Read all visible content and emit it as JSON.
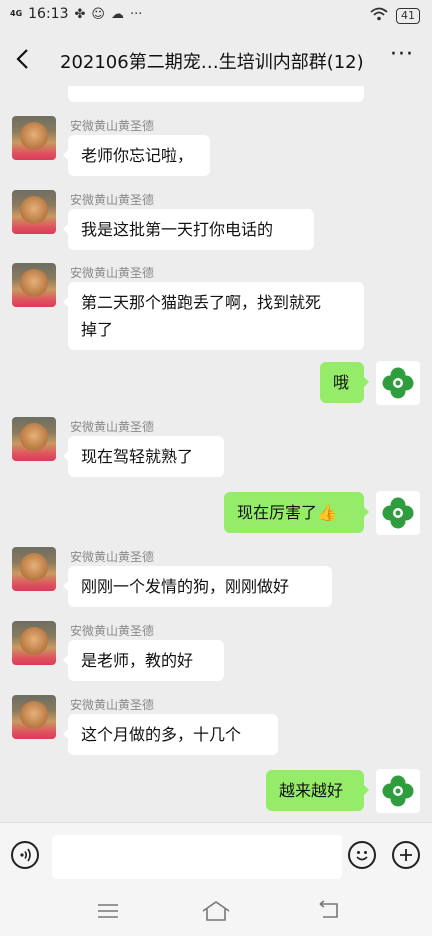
{
  "status": {
    "network": "4G",
    "time": "16:13",
    "battery": "41"
  },
  "header": {
    "title": "202106第二期宠…生培训内部群(12)"
  },
  "messages": [
    {
      "sender": "安微黄山黄圣德",
      "text": "老师你忘记啦，"
    },
    {
      "sender": "安微黄山黄圣德",
      "text": "我是这批第一天打你电话的"
    },
    {
      "sender": "安微黄山黄圣德",
      "text_line1": "第二天那个猫跑丢了啊，找到就死",
      "text_line2": "掉了"
    },
    {
      "text": "哦"
    },
    {
      "sender": "安微黄山黄圣德",
      "text": "现在驾轻就熟了"
    },
    {
      "text": "现在厉害了👍"
    },
    {
      "sender": "安微黄山黄圣德",
      "text": "刚刚一个发情的狗，刚刚做好"
    },
    {
      "sender": "安微黄山黄圣德",
      "text": "是老师，教的好"
    },
    {
      "sender": "安微黄山黄圣德",
      "text": "这个月做的多，十几个"
    },
    {
      "text": "越来越好"
    }
  ],
  "colors": {
    "background": "#ededed",
    "my_bubble": "#95ec69",
    "other_bubble": "#ffffff"
  },
  "icons": {
    "back": "chevron-left-icon",
    "more": "more-dots-icon",
    "voice": "voice-icon",
    "emoji": "emoji-icon",
    "plus": "plus-icon"
  }
}
